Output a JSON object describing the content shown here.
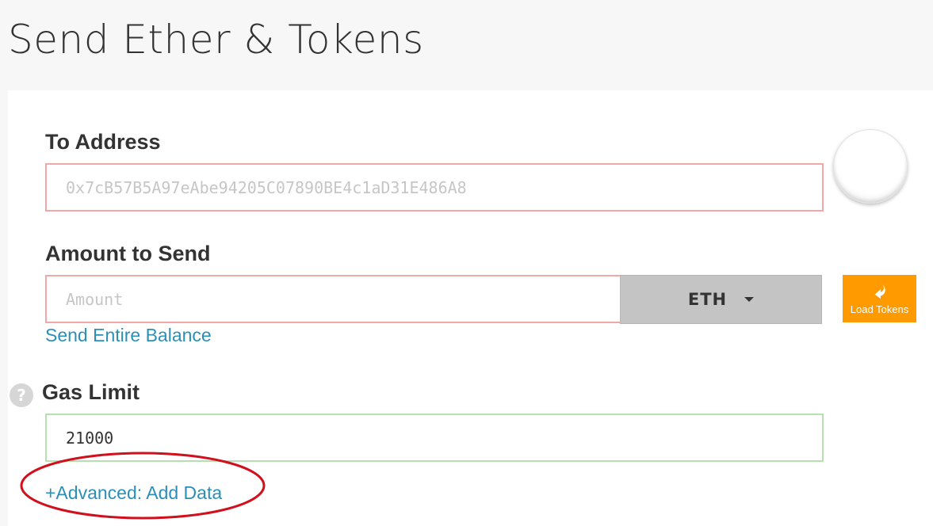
{
  "page": {
    "title": "Send Ether & Tokens"
  },
  "to_address": {
    "label": "To Address",
    "placeholder": "0x7cB57B5A97eAbe94205C07890BE4c1aD31E486A8",
    "value": ""
  },
  "amount": {
    "label": "Amount to Send",
    "placeholder": "Amount",
    "value": "",
    "unit": "ETH",
    "send_entire_balance_label": "Send Entire Balance"
  },
  "load_tokens": {
    "label": "Load Tokens",
    "icon": "arrow-down-curve-icon",
    "color": "#ff9b00"
  },
  "gas_limit": {
    "label": "Gas Limit",
    "value": "21000",
    "help_icon": "question-icon",
    "help_glyph": "?"
  },
  "advanced": {
    "label": "+Advanced: Add Data"
  },
  "colors": {
    "link": "#2b8fb8",
    "invalid_border": "#f0a9a7",
    "valid_border": "#b6e0b0",
    "annotation": "#d0101c"
  }
}
